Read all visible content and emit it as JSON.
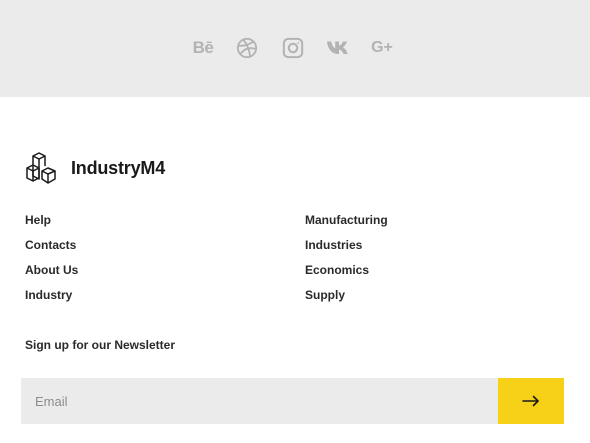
{
  "social": {
    "icons": [
      {
        "name": "behance-icon",
        "glyph": "Bē"
      },
      {
        "name": "dribbble-icon"
      },
      {
        "name": "instagram-icon"
      },
      {
        "name": "vk-icon"
      },
      {
        "name": "google-plus-icon",
        "glyph": "G+"
      }
    ],
    "icon_color": "#b3b3b3",
    "background": "#ebebeb"
  },
  "brand": {
    "name": "IndustryM4",
    "logo_icon": "cubes-icon"
  },
  "nav": {
    "left": [
      "Help",
      "Contacts",
      "About Us",
      "Industry"
    ],
    "right": [
      "Manufacturing",
      "Industries",
      "Economics",
      "Supply"
    ]
  },
  "newsletter": {
    "label": "Sign up for our Newsletter",
    "placeholder": "Email",
    "submit_icon": "arrow-right-icon",
    "accent": "#f7d117"
  }
}
